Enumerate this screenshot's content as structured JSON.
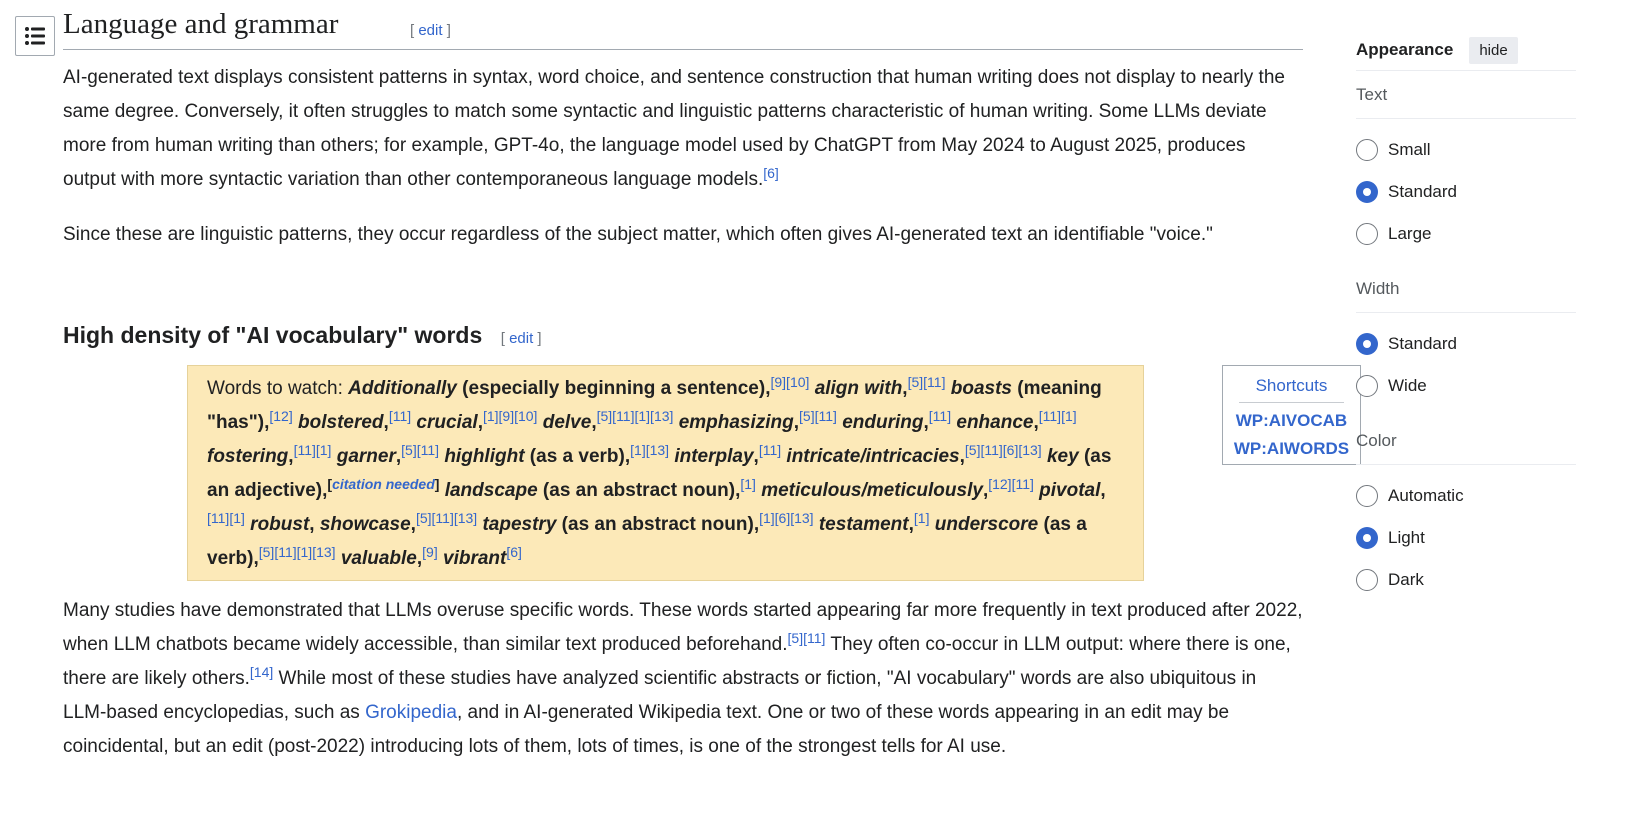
{
  "toc": {
    "icon": "list-icon"
  },
  "heading": {
    "title": "Language and grammar",
    "edit": "edit"
  },
  "p1": {
    "text": "AI-generated text displays consistent patterns in syntax, word choice, and sentence construction that human writing does not display to nearly the same degree. Conversely, it often struggles to match some syntactic and linguistic patterns characteristic of human writing. Some LLMs deviate more from human writing than others; for example, GPT-4o, the language model used by ChatGPT from May 2024 to August 2025, produces output with more syntactic variation than other contemporaneous language models.",
    "ref": "[6]"
  },
  "p2": {
    "text": "Since these are linguistic patterns, they occur regardless of the subject matter, which often gives AI-generated text an identifiable \"voice.\""
  },
  "subheading": {
    "title": "High density of \"AI vocabulary\" words",
    "edit": "edit"
  },
  "watch": {
    "intro": "Words to watch: ",
    "items": [
      {
        "word": "Additionally",
        "note": " (especially beginning a sentence),",
        "ref": "[9][10]"
      },
      {
        "word": "align with",
        "note": ",",
        "ref": "[5][11]"
      },
      {
        "word": "boasts",
        "note": " (meaning \"has\"),",
        "ref": "[12]"
      },
      {
        "word": "bolstered",
        "note": ",",
        "ref": "[11]"
      },
      {
        "word": "crucial",
        "note": ",",
        "ref": "[1][9][10]"
      },
      {
        "word": "delve",
        "note": ",",
        "ref": "[5][11][1][13]"
      },
      {
        "word": "emphasizing",
        "note": ",",
        "ref": "[5][11]"
      },
      {
        "word": "enduring",
        "note": ",",
        "ref": "[11]"
      },
      {
        "word": "enhance",
        "note": ",",
        "ref": "[11][1]"
      },
      {
        "word": "fostering",
        "note": ",",
        "ref": "[11][1]"
      },
      {
        "word": "garner",
        "note": ",",
        "ref": "[5][11]"
      },
      {
        "word": "highlight",
        "note": " (as a verb),",
        "ref": "[1][13]"
      },
      {
        "word": "interplay",
        "note": ",",
        "ref": "[11]"
      },
      {
        "word": "intricate/intricacies",
        "note": ",",
        "ref": "[5][11][6][13]"
      },
      {
        "word": "key",
        "note": " (as an adjective),",
        "ref": "[citation needed]"
      },
      {
        "word": "landscape",
        "note": " (as an abstract noun),",
        "ref": "[1]"
      },
      {
        "word": "meticulous/meticulously",
        "note": ",",
        "ref": "[12][11]"
      },
      {
        "word": "pivotal",
        "note": ",",
        "ref": "[11][1]"
      },
      {
        "word": "robust",
        "note": ", ",
        "ref": ""
      },
      {
        "word": "showcase",
        "note": ",",
        "ref": "[5][11][13]"
      },
      {
        "word": "tapestry",
        "note": " (as an abstract noun),",
        "ref": "[1][6][13]"
      },
      {
        "word": "testament",
        "note": ",",
        "ref": "[1]"
      },
      {
        "word": "underscore",
        "note": " (as a verb),",
        "ref": "[5][11][1][13]"
      },
      {
        "word": "valuable",
        "note": ",",
        "ref": "[9]"
      },
      {
        "word": "vibrant",
        "note": "",
        "ref": "[6]"
      }
    ]
  },
  "shortcuts": {
    "title": "Shortcuts",
    "items": [
      "WP:AIVOCAB",
      "WP:AIWORDS"
    ]
  },
  "p3": {
    "a": "Many studies have demonstrated that LLMs overuse specific words. These words started appearing far more frequently in text produced after 2022, when LLM chatbots became widely accessible, than similar text produced beforehand.",
    "ref1": "[5][11]",
    "b": " They often co-occur in LLM output: where there is one, there are likely others.",
    "ref2": "[14]",
    "c": " While most of these studies have analyzed scientific abstracts or fiction, \"AI vocabulary\" words are also ubiquitous in LLM-based encyclopedias, such as ",
    "link": "Grokipedia",
    "d": ", and in AI-generated Wikipedia text. One or two of these words appearing in an edit may be coincidental, but an edit (post-2022) introducing lots of them, lots of times, is one of the strongest tells for AI use."
  },
  "appearance": {
    "title": "Appearance",
    "hide": "hide",
    "text_label": "Text",
    "text_options": [
      "Small",
      "Standard",
      "Large"
    ],
    "text_selected": "Standard",
    "width_label": "Width",
    "width_options": [
      "Standard",
      "Wide"
    ],
    "width_selected": "Standard",
    "color_label": "Color",
    "color_options": [
      "Automatic",
      "Light",
      "Dark"
    ],
    "color_selected": "Light"
  },
  "colors": {
    "link": "#3366cc",
    "box_bg": "#fce9b8",
    "radio_checked": "#3366cc"
  }
}
